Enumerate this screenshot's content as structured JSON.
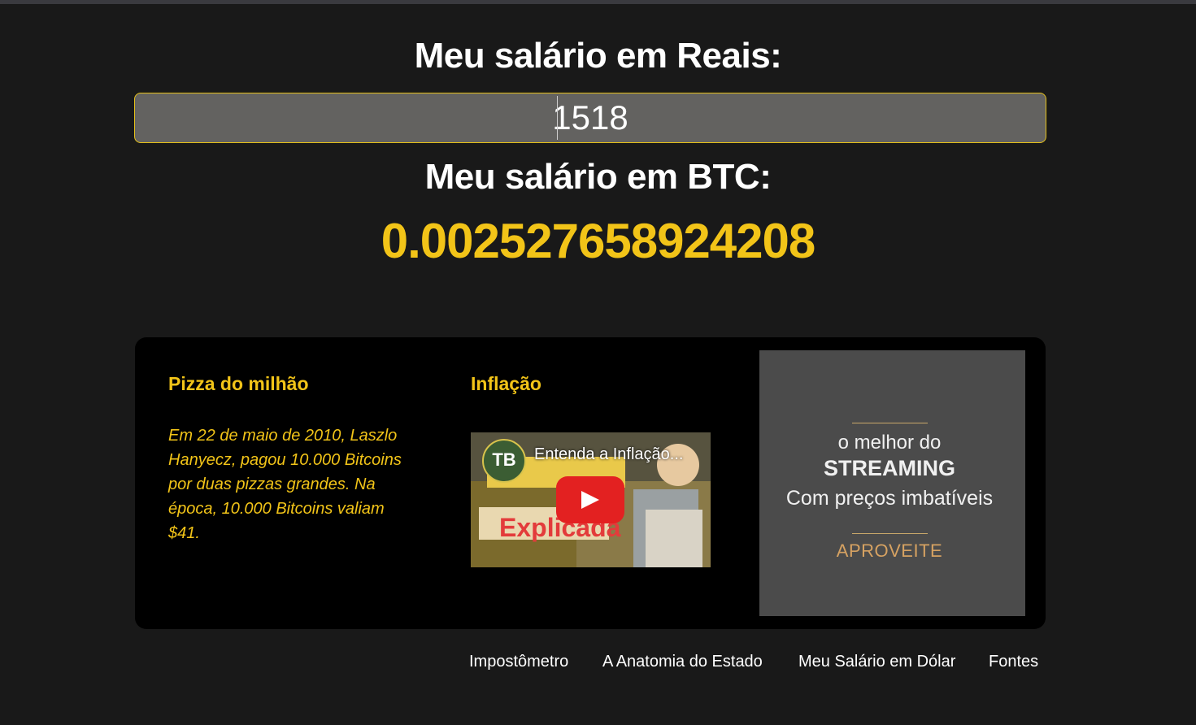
{
  "header": {
    "reais_label": "Meu salário em Reais:",
    "btc_label": "Meu salário em BTC:"
  },
  "salary_input": {
    "value": "1518"
  },
  "btc_result": {
    "value": "0.002527658924208"
  },
  "card": {
    "pizza": {
      "title": "Pizza do milhão",
      "text": "Em 22 de maio de 2010, Laszlo Hanyecz, pagou 10.000 Bitcoins por duas pizzas grandes. Na época, 10.000 Bitcoins valiam $41."
    },
    "inflacao": {
      "title": "Inflação",
      "video_title": "Entenda a Inflação...",
      "video_logo": "TB",
      "play_icon": "play-icon"
    },
    "ad": {
      "line1": "o melhor do",
      "line2": "STREAMING",
      "line3": "Com preços imbatíveis",
      "cta": "APROVEITE"
    }
  },
  "footer": {
    "links": [
      "Impostômetro",
      "A Anatomia do Estado",
      "Meu Salário em Dólar",
      "Fontes"
    ]
  },
  "colors": {
    "accent": "#f2c418",
    "background": "#191919",
    "card": "#000000",
    "input_bg": "#636260",
    "ad_bg": "#4b4b4b",
    "ad_cta": "#d6a262"
  }
}
